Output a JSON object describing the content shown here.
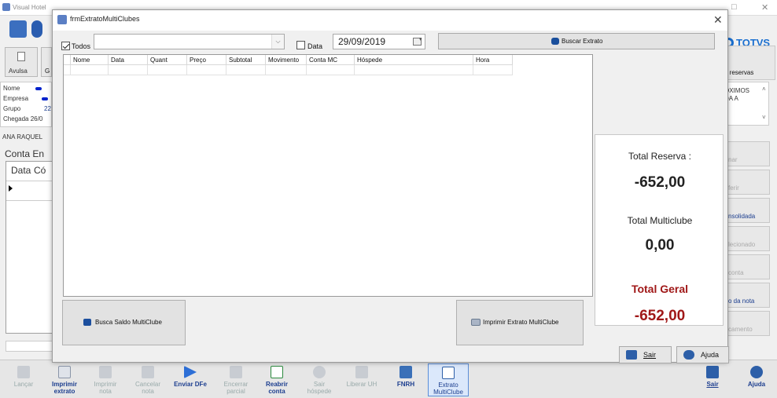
{
  "background_window": {
    "title": "Visual Hotel",
    "brand": "TOTVS",
    "left_panel": {
      "avulsa_label": "Avulsa",
      "info_labels": [
        "Nome",
        "Empresa",
        "Grupo",
        "Chegada 26/0"
      ],
      "grupo_value": "22",
      "guest_name": "ANA RAQUEL",
      "conta_label": "Conta En",
      "grid_headers": [
        "Data",
        "Có"
      ]
    },
    "right_panel": {
      "reservas_label": "o reservas",
      "proximos_label": "ÓXIMOS\nDA A",
      "buttons": [
        "nar",
        "ferir",
        "nsolidada",
        "lecionado",
        "conta",
        "o da nota",
        "camento"
      ]
    },
    "bottom_toolbar": [
      {
        "label": "Lançar",
        "enabled": false
      },
      {
        "label": "Imprimir extrato",
        "enabled": true
      },
      {
        "label": "Imprimir nota",
        "enabled": false
      },
      {
        "label": "Cancelar nota",
        "enabled": false
      },
      {
        "label": "Enviar DFe",
        "enabled": true
      },
      {
        "label": "Encerrar parcial",
        "enabled": false
      },
      {
        "label": "Reabrir conta",
        "enabled": true
      },
      {
        "label": "Sair hóspede",
        "enabled": false
      },
      {
        "label": "Liberar UH",
        "enabled": false
      },
      {
        "label": "FNRH",
        "enabled": true
      },
      {
        "label": "Extrato MultiClube",
        "enabled": true,
        "active": true
      }
    ],
    "bottom_right": [
      {
        "label": "Sair"
      },
      {
        "label": "Ajuda"
      }
    ]
  },
  "modal": {
    "title": "frmExtratoMultiClubes",
    "todos_label": "Todos",
    "todos_checked": true,
    "combo_value": "",
    "data_label": "Data",
    "data_checked": false,
    "date_value": "29/09/2019",
    "buscar_label": "Buscar Extrato",
    "grid_columns": [
      "Nome",
      "Data",
      "Quant",
      "Preço",
      "Subtotal",
      "Movimento",
      "Conta MC",
      "Hóspede",
      "Hora"
    ],
    "busca_saldo_label": "Busca Saldo MultiClube",
    "imprimir_label": "Imprimir Extrato MultiClube",
    "totals": {
      "reserva_label": "Total Reserva :",
      "reserva_value": "-652,00",
      "multiclube_label": "Total Multiclube",
      "multiclube_value": "0,00",
      "geral_label": "Total Geral",
      "geral_value": "-652,00"
    },
    "sair_label": "Sair",
    "ajuda_label": "Ajuda"
  },
  "colors": {
    "accent_blue": "#1c4f9e",
    "total_red": "#a01818",
    "brand_blue": "#1a6fd0"
  }
}
